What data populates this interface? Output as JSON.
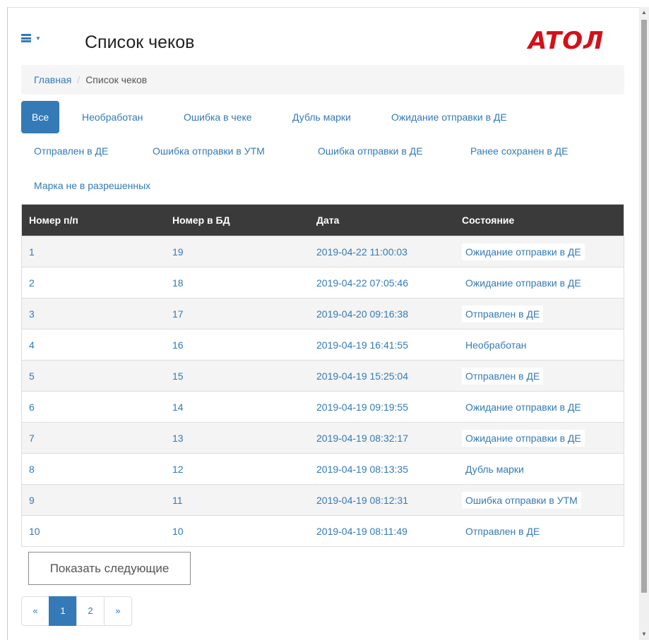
{
  "header": {
    "title": "Список чеков",
    "logo_text": "ATOЛ"
  },
  "breadcrumb": {
    "home": "Главная",
    "separator": "/",
    "current": "Список чеков"
  },
  "filters": [
    {
      "label": "Все",
      "active": true
    },
    {
      "label": "Необработан"
    },
    {
      "label": "Ошибка в чеке"
    },
    {
      "label": "Дубль марки"
    },
    {
      "label": "Ожидание отправки в ДЕ"
    },
    {
      "label": "Отправлен в ДЕ"
    },
    {
      "label": "Ошибка отправки в УТМ"
    },
    {
      "label": "Ошибка отправки в ДЕ"
    },
    {
      "label": "Ранее сохранен в ДЕ"
    },
    {
      "label": "Марка не в разрешенных"
    }
  ],
  "table": {
    "columns": [
      "Номер п/п",
      "Номер в БД",
      "Дата",
      "Состояние"
    ],
    "rows": [
      [
        "1",
        "19",
        "2019-04-22 11:00:03",
        "Ожидание отправки в ДЕ"
      ],
      [
        "2",
        "18",
        "2019-04-22 07:05:46",
        "Ожидание отправки в ДЕ"
      ],
      [
        "3",
        "17",
        "2019-04-20 09:16:38",
        "Отправлен в ДЕ"
      ],
      [
        "4",
        "16",
        "2019-04-19 16:41:55",
        "Необработан"
      ],
      [
        "5",
        "15",
        "2019-04-19 15:25:04",
        "Отправлен в ДЕ"
      ],
      [
        "6",
        "14",
        "2019-04-19 09:19:55",
        "Ожидание отправки в ДЕ"
      ],
      [
        "7",
        "13",
        "2019-04-19 08:32:17",
        "Ожидание отправки в ДЕ"
      ],
      [
        "8",
        "12",
        "2019-04-19 08:13:35",
        "Дубль марки"
      ],
      [
        "9",
        "11",
        "2019-04-19 08:12:31",
        "Ошибка отправки в УТМ"
      ],
      [
        "10",
        "10",
        "2019-04-19 08:11:49",
        "Отправлен в ДЕ"
      ]
    ]
  },
  "show_more_label": "Показать следующие",
  "pagination": {
    "prev": "«",
    "pages": [
      "1",
      "2"
    ],
    "active_page": "1",
    "next": "»"
  },
  "colors": {
    "link": "#337ab7",
    "header_bg": "#3a3a3a",
    "logo": "#d4101a"
  }
}
